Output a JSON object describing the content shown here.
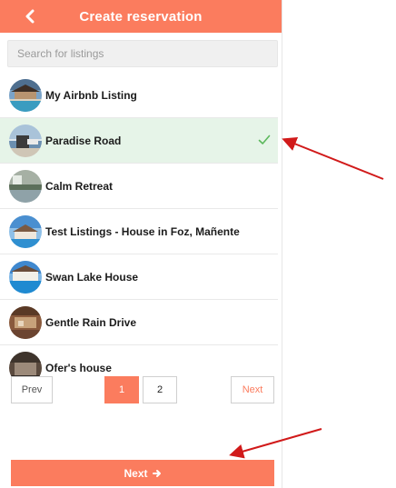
{
  "header": {
    "title": "Create reservation",
    "back_icon": "chevron-left-icon"
  },
  "search": {
    "placeholder": "Search for listings",
    "value": ""
  },
  "listings": [
    {
      "label": "My Airbnb Listing",
      "selected": false
    },
    {
      "label": "Paradise Road",
      "selected": true
    },
    {
      "label": "Calm Retreat",
      "selected": false
    },
    {
      "label": "Test Listings - House in Foz, Mañente",
      "selected": false
    },
    {
      "label": "Swan Lake House",
      "selected": false
    },
    {
      "label": "Gentle Rain Drive",
      "selected": false
    },
    {
      "label": "Ofer's house",
      "selected": false
    }
  ],
  "pagination": {
    "prev_label": "Prev",
    "pages": [
      "1",
      "2"
    ],
    "current_page": "1",
    "next_label": "Next"
  },
  "footer": {
    "next_button_label": "Next"
  },
  "colors": {
    "accent": "#fb7c5e",
    "selected_bg": "#e6f4e8",
    "check": "#5cb85c",
    "annotation_arrow": "#d11a1a"
  }
}
